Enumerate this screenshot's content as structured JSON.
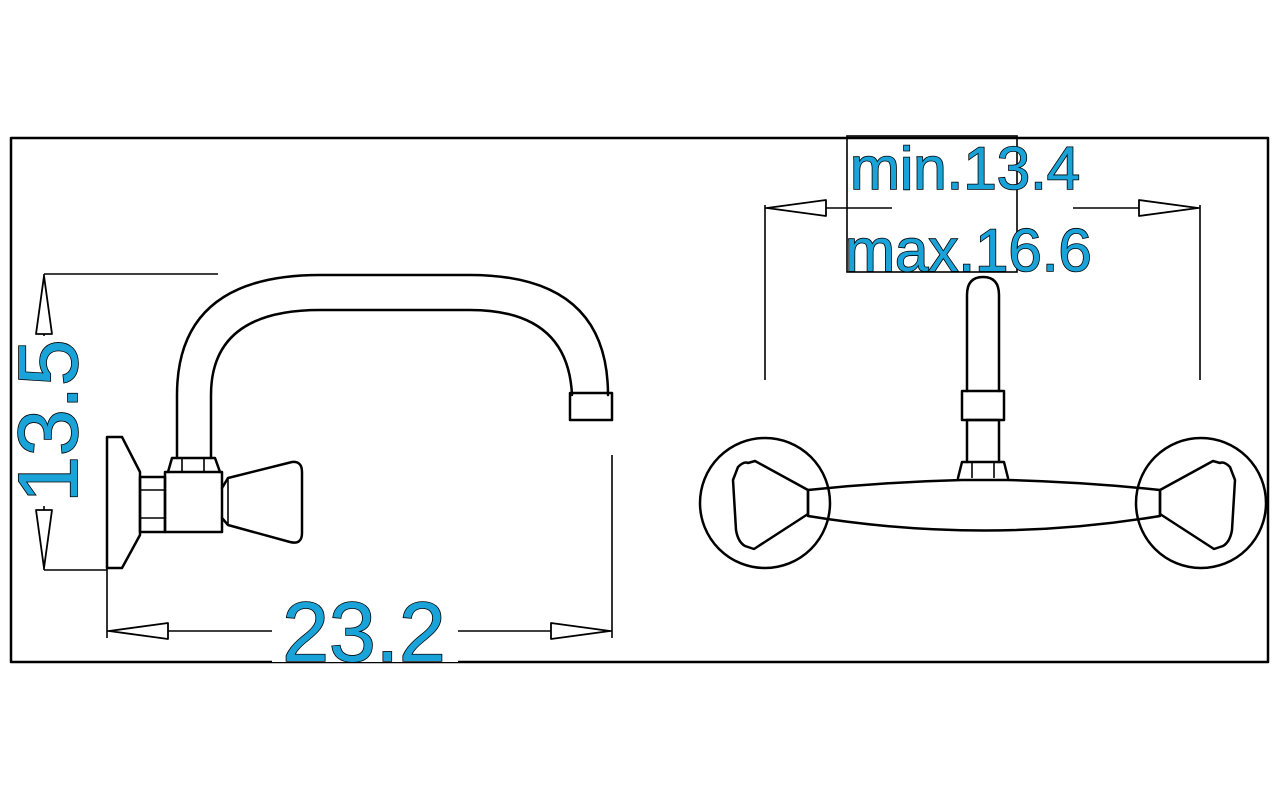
{
  "dimensions": {
    "height_label": "13.5",
    "width_label": "23.2",
    "spacing_min_label": "min.13.4",
    "spacing_max_label": "max.16.6"
  },
  "colors": {
    "dimension_text": "#1aa3d9",
    "line": "#000000",
    "background": "#ffffff"
  }
}
